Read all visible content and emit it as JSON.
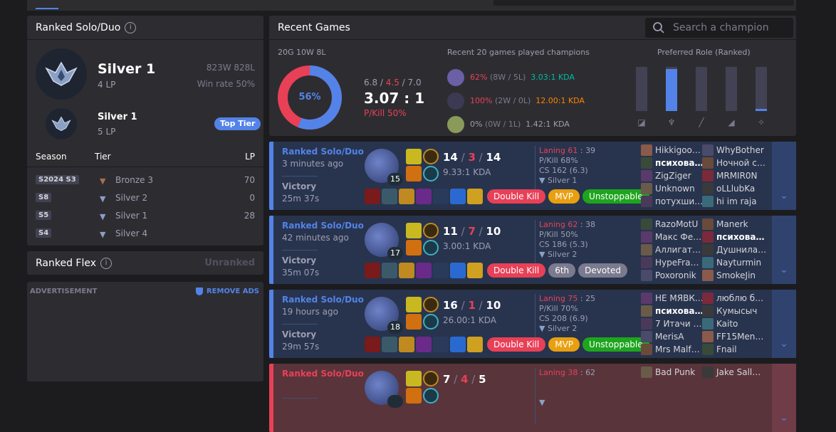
{
  "ranked_solo": {
    "title": "Ranked Solo/Duo",
    "tier": "Silver 1",
    "lp": "4 LP",
    "record": "823W 828L",
    "winrate": "Win rate 50%",
    "peak_tier": "Silver 1",
    "peak_lp": "5 LP",
    "top_tier_label": "Top Tier",
    "season_headers": [
      "Season",
      "Tier",
      "LP"
    ],
    "seasons": [
      {
        "season": "S2024 S3",
        "tier": "Bronze 3",
        "lp": "70"
      },
      {
        "season": "S8",
        "tier": "Silver 2",
        "lp": "0"
      },
      {
        "season": "S5",
        "tier": "Silver 1",
        "lp": "28"
      },
      {
        "season": "S4",
        "tier": "Silver 4",
        "lp": ""
      }
    ]
  },
  "ranked_flex": {
    "title": "Ranked Flex",
    "status": "Unranked"
  },
  "ad": {
    "label": "ADVERTISEMENT",
    "remove": "REMOVE ADS"
  },
  "recent": {
    "title": "Recent Games",
    "search_placeholder": "Search a champion",
    "summary": "20G 10W 8L",
    "winrate": "56%",
    "kda_avg": {
      "k": "6.8",
      "d": "4.5",
      "a": "7.0"
    },
    "kda_ratio": "3.07 : 1",
    "pkill": "P/Kill 50%",
    "champs_title": "Recent 20 games played champions",
    "champs": [
      {
        "wr": "62%",
        "rec": "(8W / 5L)",
        "kda": "3.03:1 KDA",
        "wr_color": "#e84057",
        "kda_color": "#00bba3"
      },
      {
        "wr": "100%",
        "rec": "(2W / 0L)",
        "kda": "12.00:1 KDA",
        "wr_color": "#e84057",
        "kda_color": "#ff8200"
      },
      {
        "wr": "0%",
        "rec": "(0W / 1L)",
        "kda": "1.42:1 KDA",
        "wr_color": "#9e9eb1",
        "kda_color": "#9e9eb1"
      }
    ],
    "role_title": "Preferred Role (Ranked)",
    "roles": [
      {
        "name": "top",
        "share": 0
      },
      {
        "name": "jungle",
        "share": 0.95
      },
      {
        "name": "mid",
        "share": 0
      },
      {
        "name": "adc",
        "share": 0
      },
      {
        "name": "support",
        "share": 0.05
      }
    ]
  },
  "games": [
    {
      "queue": "Ranked Solo/Duo",
      "ago": "3 minutes ago",
      "result": "Victory",
      "duration": "25m 37s",
      "level": "15",
      "k": "14",
      "d": "3",
      "a": "14",
      "ratio": "9.33:1 KDA",
      "laning": "Laning 61",
      "laning_b": "39",
      "pkill": "P/Kill 68%",
      "cs": "CS 162 (6.3)",
      "rank": "Silver 1",
      "tags": [
        {
          "t": "Double Kill",
          "c": "#e84057"
        },
        {
          "t": "MVP",
          "c": "#e89f10"
        },
        {
          "t": "Unstoppable",
          "c": "#1ea51e"
        }
      ],
      "blue": [
        "Hikkigoo…",
        "психова…",
        "ZigZiger",
        "Unknown",
        "потухши…"
      ],
      "red": [
        "WhyBother",
        "Ночной с…",
        "MRMIR0N",
        "oLLlubKa",
        "hi im raja"
      ],
      "me_side": 0,
      "me_idx": 1
    },
    {
      "queue": "Ranked Solo/Duo",
      "ago": "42 minutes ago",
      "result": "Victory",
      "duration": "35m 07s",
      "level": "17",
      "k": "11",
      "d": "7",
      "a": "10",
      "ratio": "3.00:1 KDA",
      "laning": "Laning 62",
      "laning_b": "38",
      "pkill": "P/Kill 50%",
      "cs": "CS 186 (5.3)",
      "rank": "Silver 2",
      "tags": [
        {
          "t": "Double Kill",
          "c": "#e84057"
        },
        {
          "t": "6th",
          "c": "#7b7a8e"
        },
        {
          "t": "Devoted",
          "c": "#7b7a8e"
        }
      ],
      "blue": [
        "RazoMotU",
        "Макс Фе…",
        "Аллигат…",
        "HypeFra…",
        "Poxoronik"
      ],
      "red": [
        "Manerk",
        "психова…",
        "Душнила…",
        "Nayturmin",
        "SmokeJin"
      ],
      "me_side": 1,
      "me_idx": 1
    },
    {
      "queue": "Ranked Solo/Duo",
      "ago": "19 hours ago",
      "result": "Victory",
      "duration": "29m 57s",
      "level": "18",
      "k": "16",
      "d": "1",
      "a": "10",
      "ratio": "26.00:1 KDA",
      "laning": "Laning 75",
      "laning_b": "25",
      "pkill": "P/Kill 70%",
      "cs": "CS 208 (6.9)",
      "rank": "Silver 2",
      "tags": [
        {
          "t": "Double Kill",
          "c": "#e84057"
        },
        {
          "t": "MVP",
          "c": "#e89f10"
        },
        {
          "t": "Unstoppable",
          "c": "#1ea51e"
        }
      ],
      "blue": [
        "НЕ МЯВК…",
        "психова…",
        "7 Итачи …",
        "MerisA",
        "Mrs Malf…"
      ],
      "red": [
        "люблю б…",
        "Кумысыч",
        "Kaito",
        "FF15Men…",
        "Fnail"
      ],
      "me_side": 0,
      "me_idx": 1
    },
    {
      "queue": "Ranked Solo/Duo",
      "ago": "",
      "result": "",
      "duration": "",
      "level": "",
      "k": "7",
      "d": "4",
      "a": "5",
      "ratio": "",
      "laning": "Laning 38",
      "laning_b": "62",
      "pkill": "",
      "cs": "",
      "rank": "",
      "tags": [],
      "blue": [
        "Bad Punk"
      ],
      "red": [
        "Jake Sall…"
      ],
      "me_side": -1,
      "me_idx": -1
    }
  ],
  "colors": {
    "accent": "#5383e8",
    "loss": "#e84057",
    "win_bg": "#28344e",
    "loss_bg": "#59343b"
  }
}
